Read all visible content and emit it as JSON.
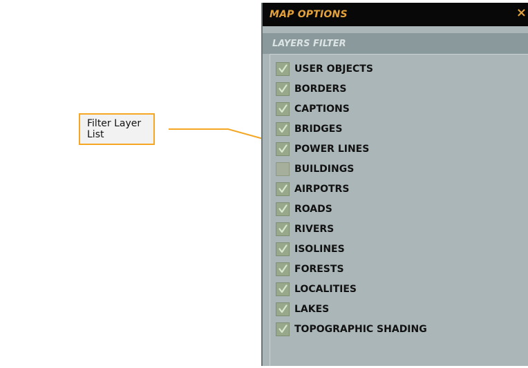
{
  "callout": {
    "text": "Filter Layer List",
    "border_color": "#f5a623",
    "arrow_color": "#f5a623"
  },
  "panel": {
    "title": "MAP OPTIONS",
    "close_symbol": "×",
    "section_title": "LAYERS FILTER",
    "title_color": "#e4a33a",
    "layers": [
      {
        "label": "USER OBJECTS",
        "checked": true
      },
      {
        "label": "BORDERS",
        "checked": true
      },
      {
        "label": "CAPTIONS",
        "checked": true
      },
      {
        "label": "BRIDGES",
        "checked": true
      },
      {
        "label": "POWER LINES",
        "checked": true
      },
      {
        "label": "BUILDINGS",
        "checked": false
      },
      {
        "label": "AIRPOTRS",
        "checked": true
      },
      {
        "label": "ROADS",
        "checked": true
      },
      {
        "label": "RIVERS",
        "checked": true
      },
      {
        "label": "ISOLINES",
        "checked": true
      },
      {
        "label": "FORESTS",
        "checked": true
      },
      {
        "label": "LOCALITIES",
        "checked": true
      },
      {
        "label": "LAKES",
        "checked": true
      },
      {
        "label": "TOPOGRAPHIC SHADING",
        "checked": true
      }
    ]
  }
}
